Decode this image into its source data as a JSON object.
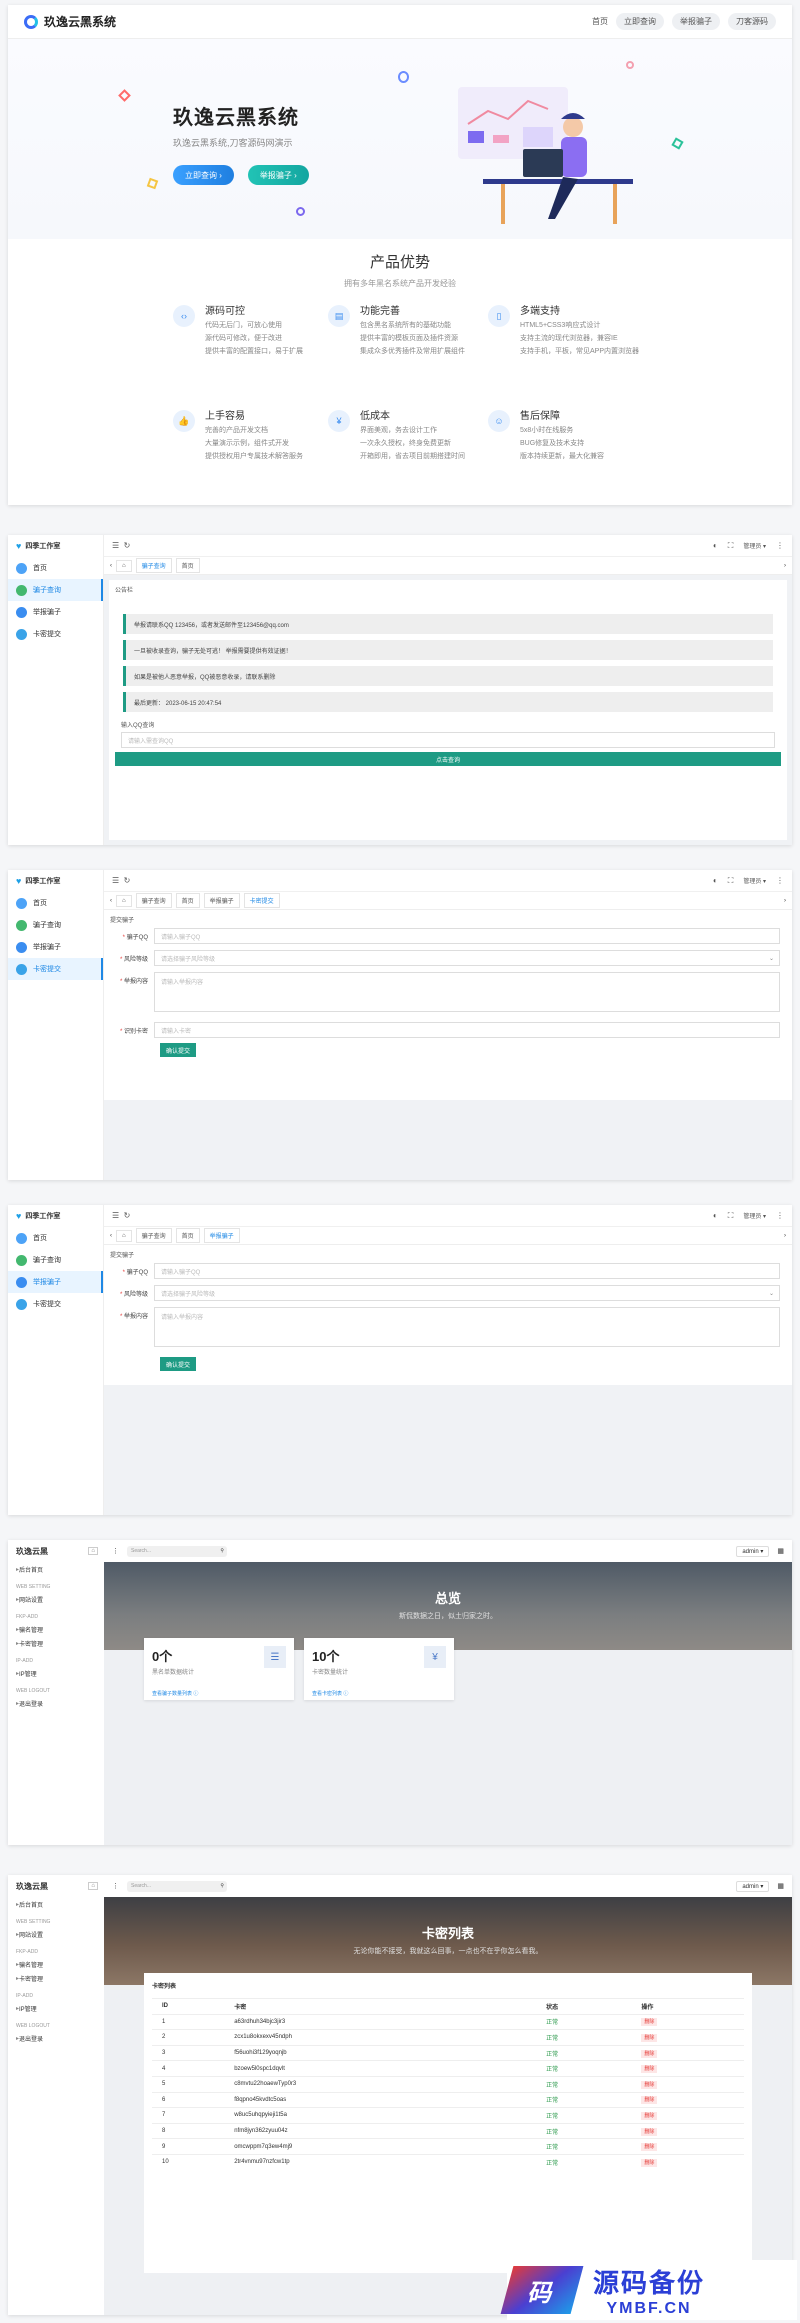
{
  "site": {
    "brand": "玖逸云黑系统",
    "nav": [
      "首页",
      "立即查询",
      "举报骗子",
      "刀客源码"
    ],
    "hero_title": "玖逸云黑系统",
    "hero_sub": "玖逸云黑系统,刀客源码网演示",
    "btn_query": "立即查询",
    "btn_report": "举报骗子",
    "section_title": "产品优势",
    "section_sub": "拥有多年黑名系统产品开发经验",
    "features": [
      {
        "icon": "code-icon",
        "title": "源码可控",
        "lines": [
          "代码无后门，可放心使用",
          "源代码可修改，便于改进",
          "提供丰富的配置接口，易于扩展"
        ]
      },
      {
        "icon": "page-icon",
        "title": "功能完善",
        "lines": [
          "包含黑名系统所有的基础功能",
          "提供丰富的模板页面及插件资源",
          "集成众多优秀插件及常用扩展组件"
        ]
      },
      {
        "icon": "phone-icon",
        "title": "多端支持",
        "lines": [
          "HTML5+CSS3响应式设计",
          "支持主流的现代浏览器，兼容IE",
          "支持手机，平板，常见APP内置浏览器"
        ]
      },
      {
        "icon": "thumb-icon",
        "title": "上手容易",
        "lines": [
          "完善的产品开发文档",
          "大量演示示例，组件式开发",
          "提供授权用户专属技术解答服务"
        ]
      },
      {
        "icon": "yen-icon",
        "title": "低成本",
        "lines": [
          "界面美观，务去设计工作",
          "一次永久授权，终身免费更新",
          "开箱即用，省去项目前期搭建时间"
        ]
      },
      {
        "icon": "service-icon",
        "title": "售后保障",
        "lines": [
          "5x8小时在线服务",
          "BUG修复及技术支持",
          "版本持续更新，最大化兼容"
        ]
      }
    ]
  },
  "admin": {
    "logo": "四季工作室",
    "menu": [
      "首页",
      "骗子查询",
      "举报骗子",
      "卡密提交"
    ],
    "user": "管理员 ▾",
    "tabs1": [
      "骗子查询",
      "首页"
    ],
    "tabs2": [
      "骗子查询",
      "首页",
      "举报骗子",
      "卡密提交"
    ],
    "tabs3": [
      "骗子查询",
      "首页",
      "举报骗子"
    ],
    "notice_label": "公告栏",
    "notices": [
      "举报请联系QQ 123456，或者发送邮件至123456@qq.com",
      "一旦被收录查询，骗子无处可逃！ 举报需要提供有效证据！",
      "如果是被他人恶意举报，QQ被恶意收录，请联系删除",
      "最后更新： 2023-06-15 20:47:54"
    ],
    "qq_label": "输入QQ查询",
    "qq_placeholder": "请输入需查询QQ",
    "query_button": "点击查询",
    "form_title": "提交骗子",
    "f_qq": "骗子QQ",
    "f_qq_ph": "请输入骗子QQ",
    "f_level": "风险等级",
    "f_level_ph": "请选择骗子风险等级",
    "f_content": "举报内容",
    "f_content_ph": "请输入举报内容",
    "f_card": "识别卡密",
    "f_card_ph": "请输入卡密",
    "submit": "确认提交"
  },
  "dash": {
    "title": "玖逸云黑",
    "search_ph": "Search...",
    "user": "admin ▾",
    "menu": [
      {
        "sec": "",
        "items": [
          "后台首页"
        ]
      },
      {
        "sec": "WEB SETTING",
        "items": [
          "网站设置"
        ]
      },
      {
        "sec": "FKP-ADD",
        "items": [
          "骗名管理",
          "卡密管理"
        ]
      },
      {
        "sec": "IP-ADD",
        "items": [
          "IP管理"
        ]
      },
      {
        "sec": "WEB LOGOUT",
        "items": [
          "退出登录"
        ]
      }
    ],
    "banner_title": "总览",
    "banner_sub": "斯侃数据之日，似土归家之时。",
    "stats": [
      {
        "n": "0个",
        "t": "黑名单数据统计",
        "l": "查看骗子数量列表 ⓘ",
        "i": "☰"
      },
      {
        "n": "10个",
        "t": "卡密数量统计",
        "l": "查看卡密列表 ⓘ",
        "i": "¥"
      }
    ],
    "banner2_title": "卡密列表",
    "banner2_sub": "无论你能不接受，我就这么回事，一点也不在乎你怎么看我。",
    "table_title": "卡密列表",
    "cols": [
      "ID",
      "卡密",
      "状态",
      "操作"
    ],
    "rows": [
      [
        "1",
        "a63rdhuh34bjc3jir3"
      ],
      [
        "2",
        "zcx1u8okxexv45ndph"
      ],
      [
        "3",
        "f56uohi3f129yoqnjb"
      ],
      [
        "4",
        "bzoew5l0spc1dqvlt"
      ],
      [
        "5",
        "c8mvtu22hoaewTyp0r3"
      ],
      [
        "6",
        "f8qpno45kvdtc5oas"
      ],
      [
        "7",
        "w8uc5uhqpyieji1t5a"
      ],
      [
        "8",
        "nfm8jyn362zyuu04z"
      ],
      [
        "9",
        "omcwppm7q3ew4mj9"
      ],
      [
        "10",
        "2tr4vnmu97nzfcw1tp"
      ]
    ],
    "status": "正常",
    "op": "删除"
  },
  "watermark": {
    "cn": "源码备份",
    "en": "YMBF.CN",
    "glyph": "码"
  }
}
